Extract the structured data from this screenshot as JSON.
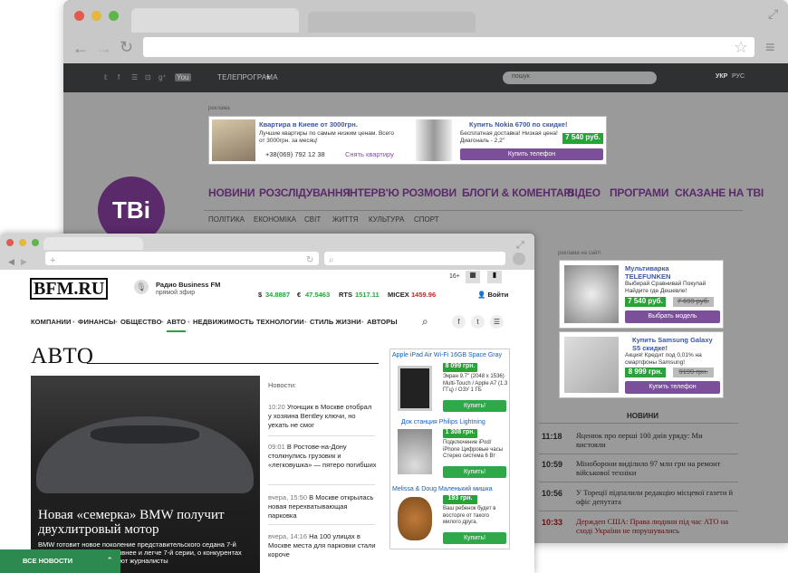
{
  "back_site": {
    "topbar": {
      "social": [
        "𝕥",
        "f",
        "☰",
        "⊡",
        "g⁺",
        "You"
      ],
      "tv_program": "ТЕЛЕПРОГРАМА",
      "search_placeholder": "пошук",
      "lang": [
        "УКР",
        "РУС"
      ]
    },
    "ad_label": "реклама",
    "ad1": {
      "title": "Квартира в Киеве от 3000грн.",
      "text": "Лучшие квартиры по самым низким ценам. Всего от 3000грн. за месяц!",
      "phone": "+38(069) 792 12 38",
      "cta": "Снять квартиру"
    },
    "ad2": {
      "title": "Купить Nokia 6700 по скидке!",
      "text": "Бесплатная доставка! Низкая цена! Диагональ - 2,2\"",
      "price": "7 540 руб.",
      "cta": "Купить телефон"
    },
    "logo": "ТВі",
    "nav": [
      "НОВИНИ",
      "РОЗСЛІДУВАННЯ",
      "ІНТЕРВ'Ю",
      "РОЗМОВИ",
      "БЛОГИ & КОМЕНТАРІ",
      "ВІДЕО",
      "ПРОГРАМИ",
      "СКАЗАНЕ НА ТВІ"
    ],
    "subnav": [
      "ПОЛІТИКА",
      "ЕКОНОМІКА",
      "СВІТ",
      "ЖИТТЯ",
      "КУЛЬТУРА",
      "СПОРТ"
    ],
    "side_ad_label": "реклама на сайті",
    "side_ad1": {
      "title": "Мультиварка TELEFUNKEN",
      "text": "Выбирай Сравнивай Покупай Найдите где Дешевле!",
      "price": "7 540 руб.",
      "old": "7 699 руб.",
      "cta": "Выбрать модель"
    },
    "side_ad2": {
      "title": "Купить Samsung Galaxy S5 скидке!",
      "text": "Акция! Кредит под 0,01% на смартфоны Samsung!",
      "price": "8 999 грн.",
      "old": "9199 грн.",
      "cta": "Купить телефон"
    },
    "news_title": "НОВИНИ",
    "news": [
      {
        "time": "11:18",
        "text": "Яценюк про перші 100 днів уряду: Ми вистояли"
      },
      {
        "time": "10:59",
        "text": "Міноборони виділило 97 млн грн на ремонт військової техніки"
      },
      {
        "time": "10:56",
        "text": "У Тореції підпалили редакцію місцевої газети й офіс депутата"
      },
      {
        "time": "10:33",
        "text": "Держдеп США: Права людини під час АТО на сході України не порушувались"
      }
    ]
  },
  "front_site": {
    "logo": "BFM.RU",
    "radio_title": "Радио Business FM",
    "radio_sub": "прямой эфир",
    "age": "16+",
    "login": "Войти",
    "stocks": [
      {
        "label": "$",
        "value": "34.8887",
        "color": "#2aa23a"
      },
      {
        "label": "€",
        "value": "47.5463",
        "color": "#2aa23a"
      },
      {
        "label": "RTS",
        "value": "1517.11",
        "color": "#2aa23a"
      },
      {
        "label": "MICEX",
        "value": "1459.96",
        "color": "#d02020"
      }
    ],
    "nav": [
      "КОМПАНИИ",
      "ФИНАНСЫ",
      "ОБЩЕСТВО",
      "АВТО",
      "НЕДВИЖИМОСТЬ",
      "ТЕХНОЛОГИИ",
      "СТИЛЬ ЖИЗНИ",
      "АВТОРЫ"
    ],
    "section_title": "АВТО",
    "hero_title": "Новая «семерка» BMW получит двухлитровый мотор",
    "hero_desc": "BMW готовит новое поколение представительского седана 7-й серии. Оно будет и спортивнее и легче 7-й серии, о конкурентах BMW активно рассказывают журналисты",
    "news_label": "Новости:",
    "news": [
      {
        "time": "10:20",
        "text": "Угонщик в Москве отобрал у хозяина Bentley ключи, но уехать не смог"
      },
      {
        "time": "09:01",
        "text": "В Ростове-на-Дону столкнулись грузовик и «легковушка» — пятеро погибших"
      },
      {
        "time": "вчера, 15:50",
        "text": "В Москве открылась новая перехватывающая парковка"
      },
      {
        "time": "вчера, 14:16",
        "text": "На 100 улицах в Москве места для парковки стали короче"
      }
    ],
    "ads": [
      {
        "title": "Apple iPad Air Wi-Fi 16GB Space Gray",
        "price": "8 099 грн.",
        "text": "Экран 9.7\" (2048 x 1536) Multi-Touch / Apple A7 (1.3 ГГц) / ОЗУ 1 ГБ",
        "cta": "Купить!"
      },
      {
        "title": "Док станция Philips Lightning",
        "price": "1 308 грн.",
        "text": "Подключение iPod/ iPhone Цифровые часы Стерео система 6 Вт",
        "cta": "Купить!"
      },
      {
        "title": "Melissa & Doug Маленький мишка",
        "price": "193 грн.",
        "text": "Ваш ребенок будет в восторге от такого милого друга.",
        "cta": "Купить!"
      }
    ],
    "all_news": "ВСЕ НОВОСТИ"
  }
}
